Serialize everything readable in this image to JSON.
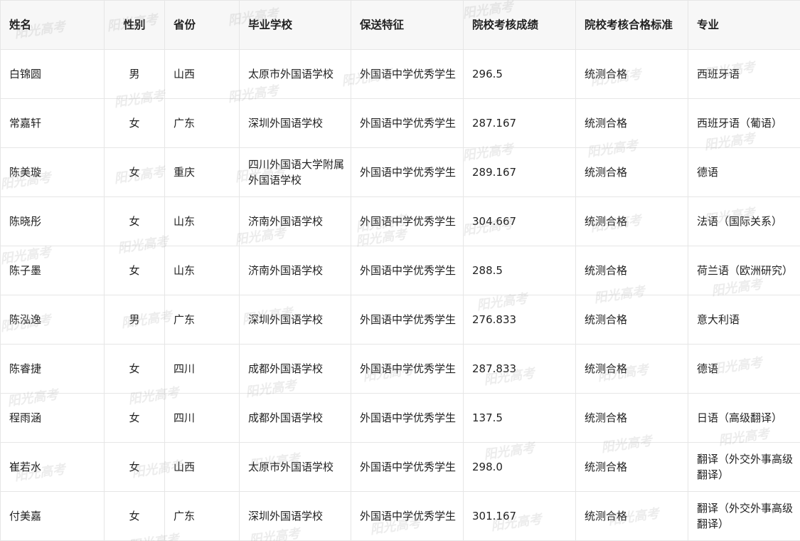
{
  "watermark": "阳光高考",
  "table": {
    "headers": [
      "姓名",
      "性别",
      "省份",
      "毕业学校",
      "保送特征",
      "院校考核成绩",
      "院校考核合格标准",
      "专业"
    ],
    "rows": [
      [
        "白锦圆",
        "男",
        "山西",
        "太原市外国语学校",
        "外国语中学优秀学生",
        "296.5",
        "统测合格",
        "西班牙语"
      ],
      [
        "常嘉轩",
        "女",
        "广东",
        "深圳外国语学校",
        "外国语中学优秀学生",
        "287.167",
        "统测合格",
        "西班牙语（葡语）"
      ],
      [
        "陈美璇",
        "女",
        "重庆",
        "四川外国语大学附属外国语学校",
        "外国语中学优秀学生",
        "289.167",
        "统测合格",
        "德语"
      ],
      [
        "陈晓彤",
        "女",
        "山东",
        "济南外国语学校",
        "外国语中学优秀学生",
        "304.667",
        "统测合格",
        "法语（国际关系）"
      ],
      [
        "陈子墨",
        "女",
        "山东",
        "济南外国语学校",
        "外国语中学优秀学生",
        "288.5",
        "统测合格",
        "荷兰语（欧洲研究）"
      ],
      [
        "陈泓逸",
        "男",
        "广东",
        "深圳外国语学校",
        "外国语中学优秀学生",
        "276.833",
        "统测合格",
        "意大利语"
      ],
      [
        "陈睿捷",
        "女",
        "四川",
        "成都外国语学校",
        "外国语中学优秀学生",
        "287.833",
        "统测合格",
        "德语"
      ],
      [
        "程雨涵",
        "女",
        "四川",
        "成都外国语学校",
        "外国语中学优秀学生",
        "137.5",
        "统测合格",
        "日语（高级翻译）"
      ],
      [
        "崔若水",
        "女",
        "山西",
        "太原市外国语学校",
        "外国语中学优秀学生",
        "298.0",
        "统测合格",
        "翻译（外交外事高级翻译）"
      ],
      [
        "付美嘉",
        "女",
        "广东",
        "深圳外国语学校",
        "外国语中学优秀学生",
        "301.167",
        "统测合格",
        "翻译（外交外事高级翻译）"
      ]
    ]
  }
}
